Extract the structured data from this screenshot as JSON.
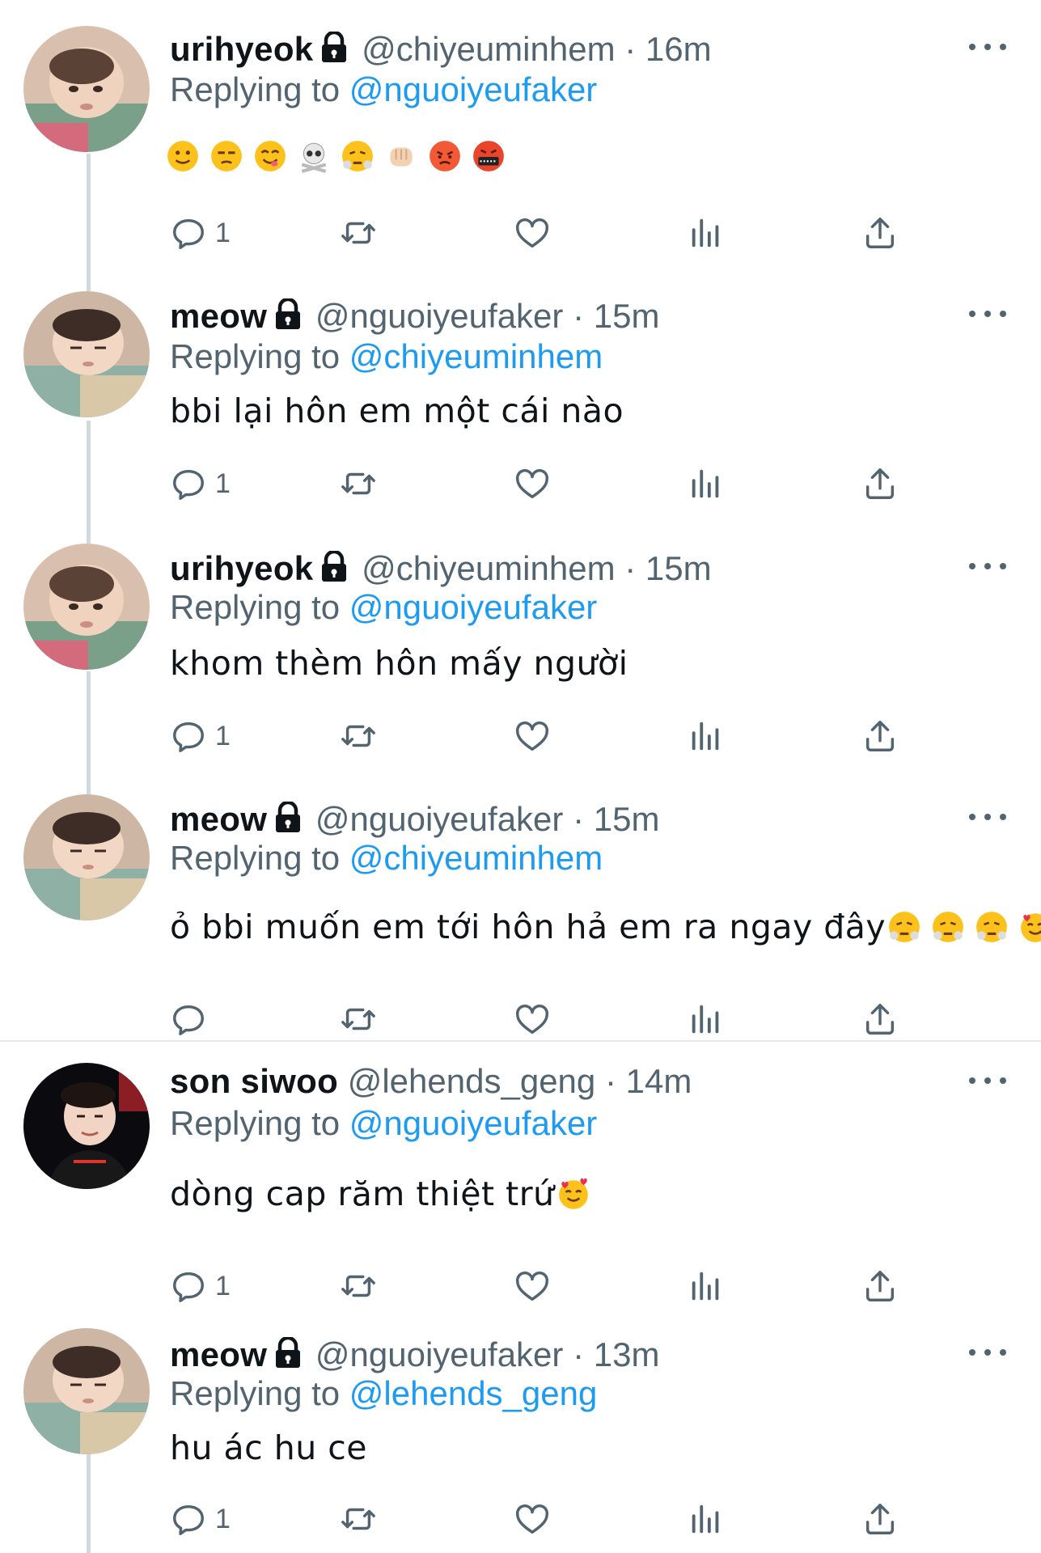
{
  "tweets": [
    {
      "name": "urihyeok",
      "handle": "@chiyeuminhem",
      "sep": "·",
      "time": "16m",
      "replying_prefix": "Replying to",
      "replying_to": "@nguoiyeufaker",
      "text": "",
      "emoji_icons": [
        "slightly-smiling-face",
        "unamused-face",
        "face-savoring-food",
        "skull-and-crossbones",
        "face-with-steam",
        "oncoming-fist",
        "pouting-face",
        "face-with-symbols-on-mouth"
      ],
      "reply_count": "1",
      "verified_lock": true
    },
    {
      "name": "meow",
      "handle": "@nguoiyeufaker",
      "sep": "·",
      "time": "15m",
      "replying_prefix": "Replying to",
      "replying_to": "@chiyeuminhem",
      "text": "bbi lại hôn em một cái nào",
      "reply_count": "1",
      "verified_lock": true
    },
    {
      "name": "urihyeok",
      "handle": "@chiyeuminhem",
      "sep": "·",
      "time": "15m",
      "replying_prefix": "Replying to",
      "replying_to": "@nguoiyeufaker",
      "text": "khom thèm hôn mấy người",
      "reply_count": "1",
      "verified_lock": true
    },
    {
      "name": "meow",
      "handle": "@nguoiyeufaker",
      "sep": "·",
      "time": "15m",
      "replying_prefix": "Replying to",
      "replying_to": "@chiyeuminhem",
      "text": "ỏ bbi muốn em tới hôn hả em ra ngay đây",
      "trailing_emoji_icons": [
        "face-with-steam",
        "face-with-steam",
        "face-with-steam",
        "smiling-face-with-hearts"
      ],
      "reply_count": "",
      "verified_lock": true
    },
    {
      "name": "son siwoo",
      "handle": "@lehends_geng",
      "sep": "·",
      "time": "14m",
      "replying_prefix": "Replying to",
      "replying_to": "@nguoiyeufaker",
      "text": "dòng cap răm thiệt trứ",
      "trailing_emoji_icons": [
        "smiling-face-with-hearts"
      ],
      "reply_count": "1",
      "verified_lock": false
    },
    {
      "name": "meow",
      "handle": "@nguoiyeufaker",
      "sep": "·",
      "time": "13m",
      "replying_prefix": "Replying to",
      "replying_to": "@lehends_geng",
      "text": "hu ác hu ce",
      "reply_count": "1",
      "verified_lock": true
    }
  ],
  "icons": {
    "reply": "reply-icon",
    "retweet": "retweet-icon",
    "like": "heart-icon",
    "views": "views-icon",
    "share": "share-icon",
    "more": "more-icon",
    "lock": "lock-icon"
  },
  "colors": {
    "link": "#1d9bf0",
    "secondary_text": "#536471",
    "primary_text": "#0f1419",
    "thread_line": "#cfd9de",
    "divider": "#e7e9ea"
  }
}
